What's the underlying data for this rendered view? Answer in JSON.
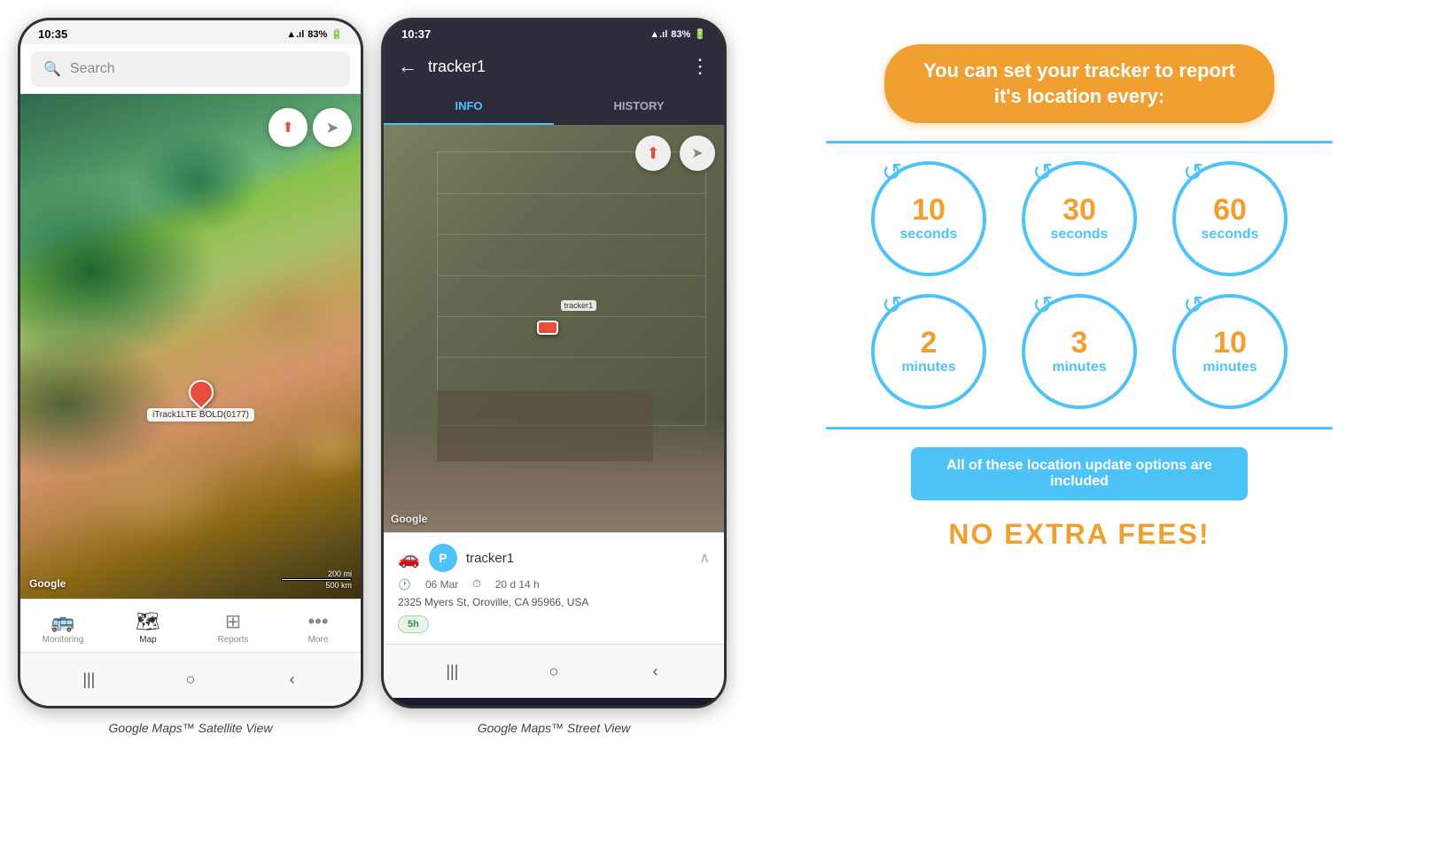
{
  "phone1": {
    "status_bar": {
      "time": "10:35",
      "battery": "83%",
      "signal": "▲▲▲",
      "wifi": "WiFi"
    },
    "search": {
      "placeholder": "Search"
    },
    "map": {
      "compass": "⬆",
      "tracker_label": "iTrack1LTE BOLD(0177)",
      "scale_200mi": "200 mi",
      "scale_500km": "500 km",
      "google_watermark": "Google"
    },
    "nav": {
      "monitoring_label": "Monitoring",
      "map_label": "Map",
      "reports_label": "Reports",
      "more_label": "More"
    },
    "caption": "Google Maps™ Satellite View"
  },
  "phone2": {
    "status_bar": {
      "time": "10:37",
      "battery": "83%",
      "signal": "▲▲▲",
      "wifi": "WiFi"
    },
    "header": {
      "back_icon": "←",
      "title": "tracker1",
      "more_icon": "⋮"
    },
    "tabs": {
      "info": "INFO",
      "history": "HISTORY"
    },
    "map": {
      "compass": "⬆",
      "tracker_label": "tracker1",
      "google_watermark": "Google"
    },
    "info_panel": {
      "tracker_name": "tracker1",
      "tracker_icon": "P",
      "car_icon": "🚗",
      "date": "06 Mar",
      "duration": "20 d 14 h",
      "address": "2325 Myers St, Oroville, CA 95966, USA",
      "badge": "5h"
    },
    "caption": "Google Maps™ Street View"
  },
  "infographic": {
    "header": "You can set your tracker to report it's location every:",
    "circles_row1": [
      {
        "number": "10",
        "unit": "seconds"
      },
      {
        "number": "30",
        "unit": "seconds"
      },
      {
        "number": "60",
        "unit": "seconds"
      }
    ],
    "circles_row2": [
      {
        "number": "2",
        "unit": "minutes"
      },
      {
        "number": "3",
        "unit": "minutes"
      },
      {
        "number": "10",
        "unit": "minutes"
      }
    ],
    "included_text": "All of these location update options are included",
    "no_extra_fees": "NO EXTRA FEES!"
  }
}
